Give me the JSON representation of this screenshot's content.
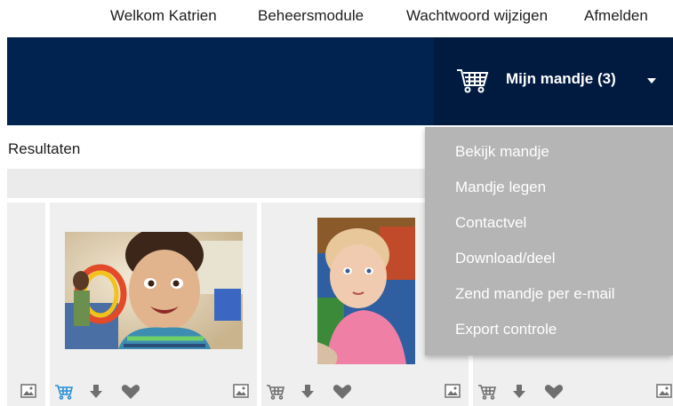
{
  "topnav": {
    "welcome": "Welkom Katrien",
    "admin": "Beheersmodule",
    "change_password": "Wachtwoord wijzigen",
    "logout": "Afmelden"
  },
  "cart": {
    "label": "Mijn mandje (3)",
    "icon": "cart-icon"
  },
  "results": {
    "title": "Resultaten"
  },
  "dropdown": {
    "items": [
      "Bekijk mandje",
      "Mandje legen",
      "Contactvel",
      "Download/deel",
      "Zend mandje per e-mail",
      "Export controle"
    ]
  },
  "colors": {
    "header": "#00234f",
    "cart_area": "#001b3f",
    "dropdown_bg": "#b5b5b5",
    "cart_active": "#2a8fd6",
    "icon_gray": "#6f6f6f"
  },
  "card_icons": [
    "image-icon",
    "cart-icon",
    "download-icon",
    "heart-icon"
  ]
}
